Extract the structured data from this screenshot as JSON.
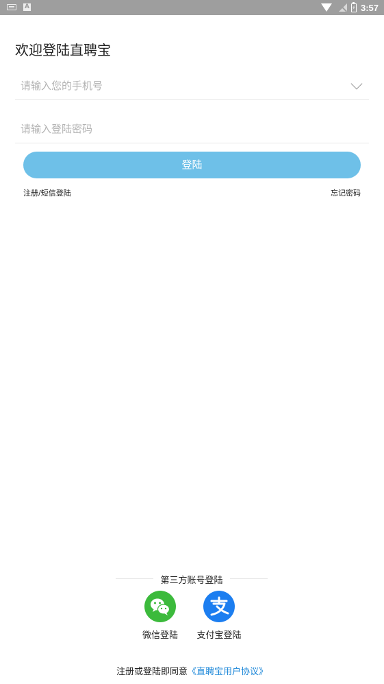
{
  "status_bar": {
    "time": "3:57",
    "a_indicator": "A",
    "battery_glyph": "⚡"
  },
  "title": "欢迎登陆直聘宝",
  "phone_field": {
    "placeholder": "请输入您的手机号",
    "value": ""
  },
  "password_field": {
    "placeholder": "请输入登陆密码",
    "value": ""
  },
  "login_button": {
    "label": "登陆",
    "color": "#6ec0e8"
  },
  "links": {
    "register_sms": "注册/短信登陆",
    "forgot_password": "忘记密码"
  },
  "third_party": {
    "heading": "第三方账号登陆",
    "wechat_label": "微信登陆",
    "alipay_label": "支付宝登陆",
    "wechat_color": "#3cba3c",
    "alipay_color": "#1c7ef0"
  },
  "agreement": {
    "prefix": "注册或登陆即同意",
    "link": "《直聘宝用户协议》",
    "link_color": "#1a86d8"
  },
  "icons": [
    "keyboard-icon",
    "a-icon",
    "wifi-icon",
    "no-signal-icon",
    "battery-icon",
    "chevron-down-icon",
    "wechat-icon",
    "alipay-icon"
  ]
}
